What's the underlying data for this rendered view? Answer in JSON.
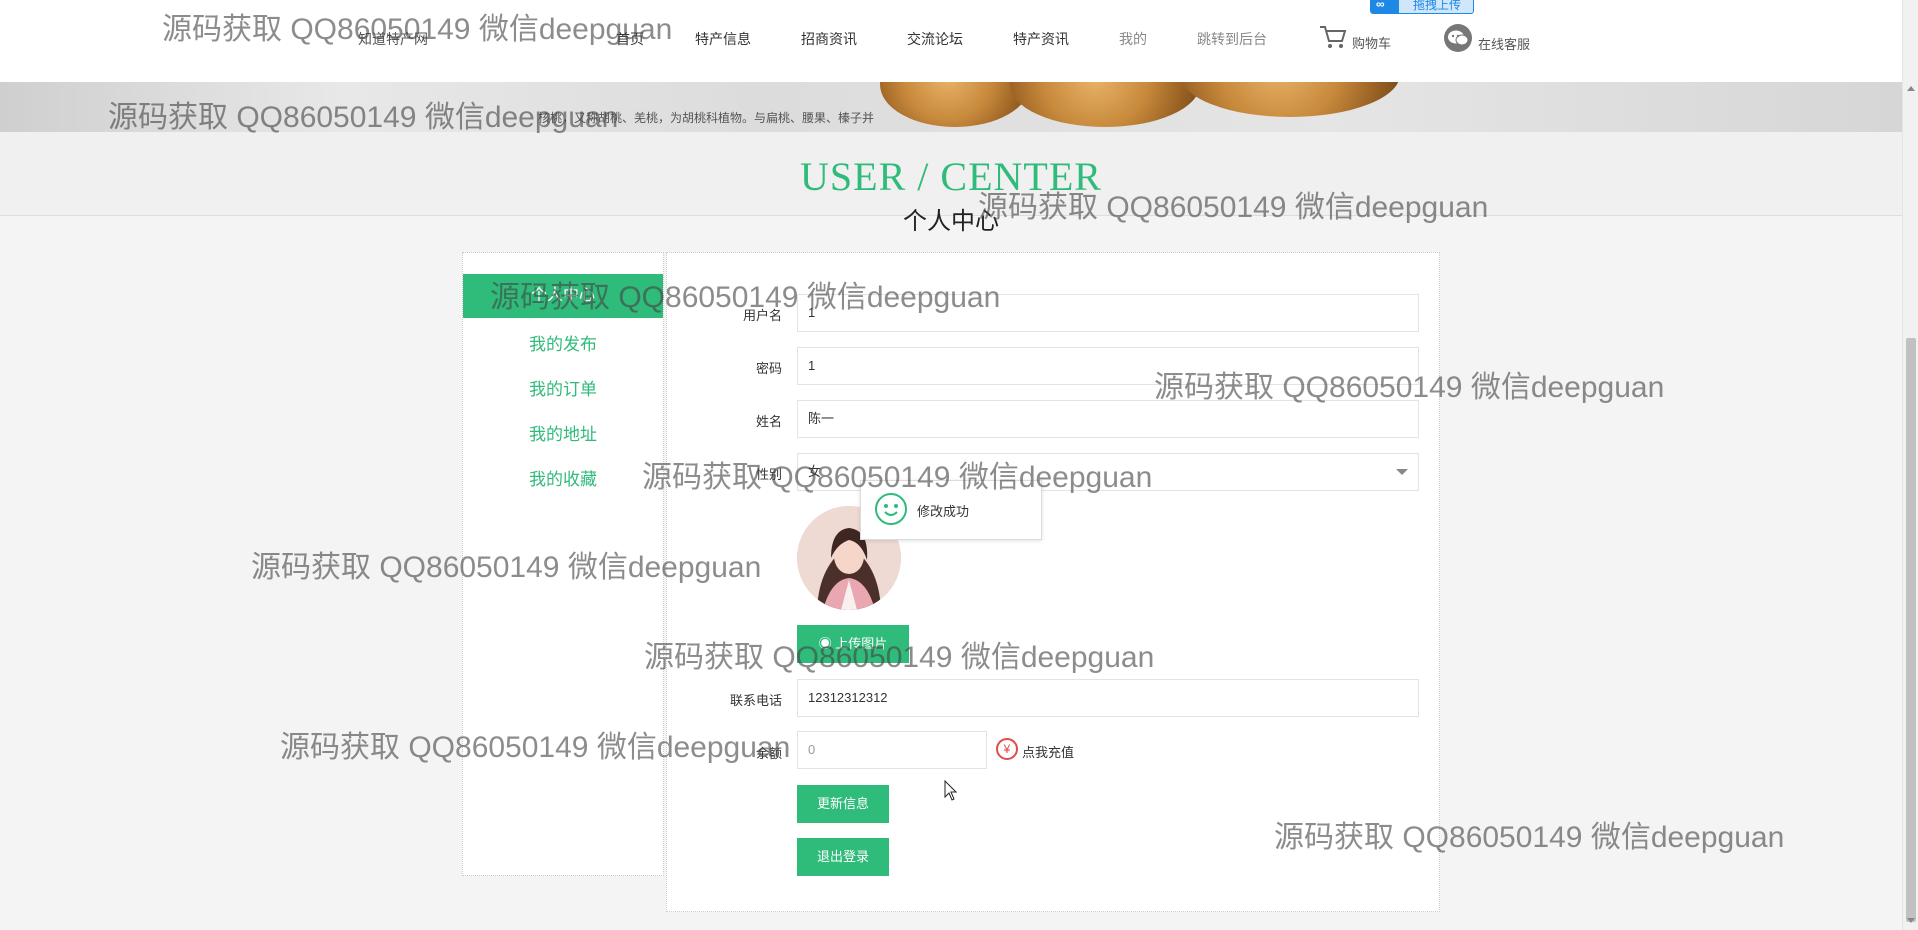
{
  "header": {
    "site_name": "知道特产网",
    "nav": [
      {
        "label": "首页"
      },
      {
        "label": "特产信息"
      },
      {
        "label": "招商资讯"
      },
      {
        "label": "交流论坛"
      },
      {
        "label": "特产资讯"
      },
      {
        "label": "我的"
      },
      {
        "label": "跳转到后台"
      }
    ],
    "upload_badge": "拖拽上传",
    "cart": "购物车",
    "service": "在线客服"
  },
  "banner": {
    "text": "核桃，又称胡桃、羌桃，为胡桃科植物。与扁桃、腰果、榛子并"
  },
  "page_title": {
    "en": "USER / CENTER",
    "cn": "个人中心"
  },
  "side_menu": {
    "items": [
      {
        "label": "个人中心"
      },
      {
        "label": "我的发布"
      },
      {
        "label": "我的订单"
      },
      {
        "label": "我的地址"
      },
      {
        "label": "我的收藏"
      }
    ]
  },
  "form": {
    "username": {
      "label": "用户名",
      "value": "1"
    },
    "password": {
      "label": "密码",
      "value": "1"
    },
    "name": {
      "label": "姓名",
      "value": "陈一"
    },
    "gender": {
      "label": "性别",
      "value": "女"
    },
    "upload_button": "上传图片",
    "phone": {
      "label": "联系电话",
      "value": "12312312312"
    },
    "balance": {
      "label": "余额",
      "value": "0"
    },
    "recharge": "点我充值",
    "update_button": "更新信息",
    "logout_button": "退出登录"
  },
  "toast": {
    "message": "修改成功"
  },
  "watermark": "源码获取 QQ86050149 微信deepguan",
  "colors": {
    "accent": "#2fbb7a",
    "recharge_icon": "#e04b4b"
  }
}
